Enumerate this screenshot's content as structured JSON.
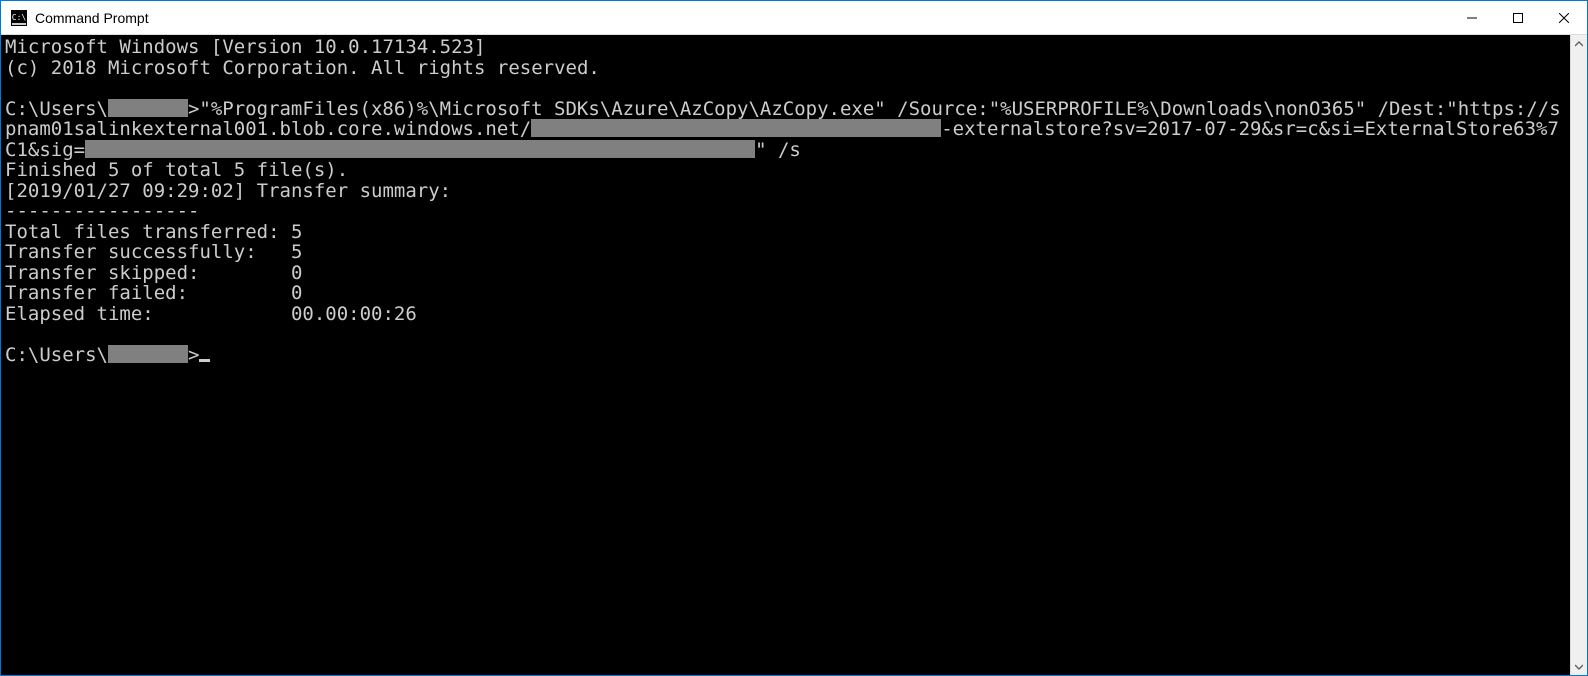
{
  "window": {
    "title": "Command Prompt",
    "icon_label": "C:\\"
  },
  "terminal": {
    "line_version": "Microsoft Windows [Version 10.0.17134.523]",
    "line_copyright": "(c) 2018 Microsoft Corporation. All rights reserved.",
    "prompt_prefix": "C:\\Users\\",
    "prompt_gt": ">",
    "cmd_part1": "\"%ProgramFiles(x86)%\\Microsoft SDKs\\Azure\\AzCopy\\AzCopy.exe\" /Source:\"%USERPROFILE%\\Downloads\\nonO365\" /Dest:\"https://spnam01salinkexternal001.blob.core.windows.net/",
    "cmd_part2": "-externalstore?sv=2017-07-29&sr=c&si=ExternalStore63%7C1&sig=",
    "cmd_part3": "\" /s",
    "out_finished": "Finished 5 of total 5 file(s).",
    "out_summary_header": "[2019/01/27 09:29:02] Transfer summary:",
    "out_separator": "-----------------",
    "out_total": "Total files transferred: 5",
    "out_success": "Transfer successfully:   5",
    "out_skipped": "Transfer skipped:        0",
    "out_failed": "Transfer failed:         0",
    "out_elapsed": "Elapsed time:            00.00:00:26",
    "redact_widths": {
      "user": 80,
      "container": 410,
      "sig": 670
    }
  }
}
